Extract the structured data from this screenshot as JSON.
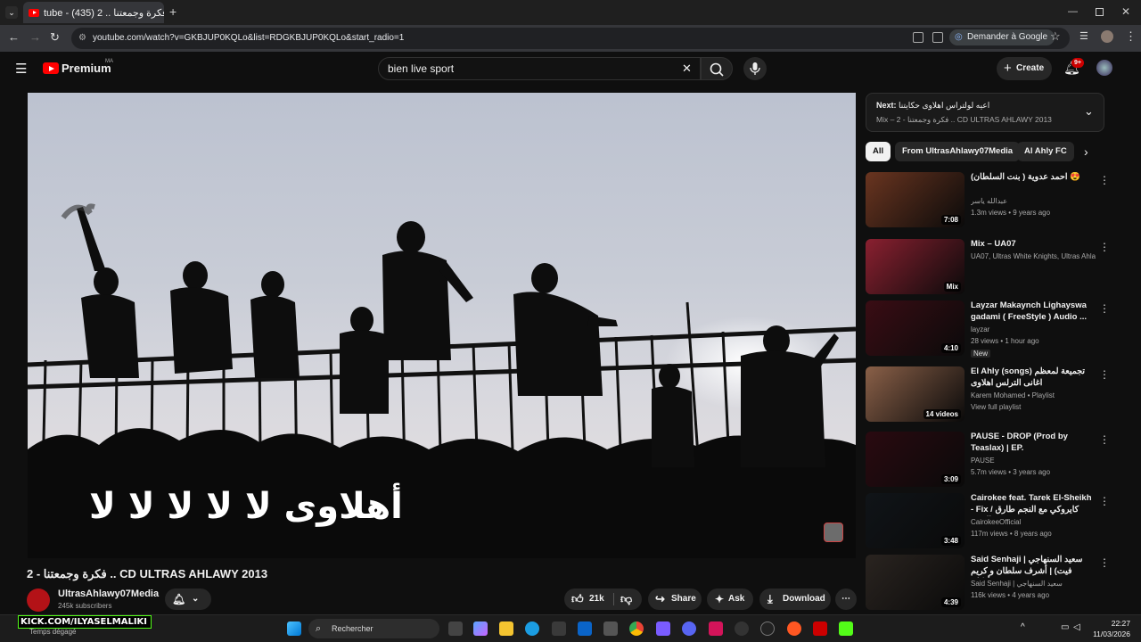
{
  "browser": {
    "tab_title": "tube - فكرة وجمعتنا .. 2 (435)",
    "url": "youtube.com/watch?v=GKBJUP0KQLo&list=RDGKBJUP0KQLo&start_radio=1",
    "ask_google": "Demander à Google"
  },
  "youtube": {
    "logo": "Premium",
    "region": "MA",
    "search_value": "bien live sport",
    "create_label": "Create",
    "notif_badge": "9+"
  },
  "video": {
    "overlay_text": "أهلاوى لا لا لا لا لا",
    "title": "2 - فكرة وجمعتنا .. CD ULTRAS AHLAWY 2013",
    "channel": "UltrasAhlawy07Media",
    "subscribers": "245k subscribers",
    "likes": "21k",
    "share": "Share",
    "ask": "Ask",
    "download": "Download"
  },
  "sidebar": {
    "next_prefix": "Next:",
    "next_title": "اعيه لولتراس اهلاوى حكايتنا",
    "next_sub": "Mix – 2 - فكرة وجمعتنا .. CD ULTRAS AHLAWY 2013",
    "chips": [
      "All",
      "From UltrasAhlawy07Media",
      "Al Ahly FC"
    ],
    "items": [
      {
        "title": "احمد عدوية ( بنت السلطان) 😍",
        "channel": "عبدالله ياسر",
        "meta": "1.3m views • 9 years ago",
        "duration": "7:08",
        "color": "#6a3520"
      },
      {
        "title": "Mix – UA07",
        "channel": "UA07, Ultras White Knights, Ultras Ahlaw...",
        "meta": "",
        "duration": "Mix",
        "color": "#8a2030"
      },
      {
        "title": "Layzar Makaynch Lighayswa gadami ( FreeStyle ) Audio ...",
        "channel": "layzar",
        "meta": "28 views • 1 hour ago",
        "badge": "New",
        "duration": "4:10",
        "color": "#3a0d14"
      },
      {
        "title": "El Ahly (songs) تجميعة لمعظم اغانى الترلس اهلاوى",
        "channel": "Karem Mohamed • Playlist",
        "meta": "View full playlist",
        "duration": "14 videos",
        "color": "#8a6048"
      },
      {
        "title": "PAUSE - DROP (Prod by Teaslax) | EP. METAMORPHOSE",
        "channel": "PAUSE",
        "meta": "5.7m views • 3 years ago",
        "duration": "3:09",
        "color": "#2a0a10"
      },
      {
        "title": "Cairokee feat. Tarek El-Sheikh - Fix / كايروكي مع النجم طارق الشيخ ...",
        "channel": "CairokeeOfficial",
        "meta": "117m views • 8 years ago",
        "duration": "3:48",
        "color": "#101418"
      },
      {
        "title": "Said Senhaji | سعيد السنهاجي فيت) | أشرف سلطان و كريم جوهري - أركان ...",
        "channel": "Said Senhaji | سعيد السنهاجي",
        "meta": "116k views • 4 years ago",
        "duration": "4:39",
        "color": "#2a2420"
      }
    ]
  },
  "taskbar": {
    "search": "Rechercher",
    "time": "22:27",
    "date": "11/03/2026",
    "weather": "Temps dégagé",
    "overlay_watermark": "KICK.COM/ILYASELMALIKI"
  }
}
